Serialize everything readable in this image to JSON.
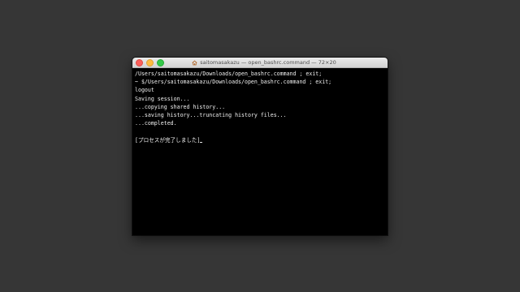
{
  "window": {
    "title": "saitomasakazu — open_bashrc.command — 72×20",
    "title_icon": "home-icon",
    "traffic_lights": {
      "close_color": "#fc605b",
      "minimize_color": "#fdbc40",
      "maximize_color": "#34c84a"
    }
  },
  "terminal": {
    "background": "#000000",
    "foreground": "#f0f0f0",
    "lines": [
      "/Users/saitomasakazu/Downloads/open_bashrc.command ; exit;",
      "~ $/Users/saitomasakazu/Downloads/open_bashrc.command ; exit;",
      "logout",
      "Saving session...",
      "...copying shared history...",
      "...saving history...truncating history files...",
      "...completed.",
      "",
      "[プロセスが完了しました]"
    ]
  }
}
